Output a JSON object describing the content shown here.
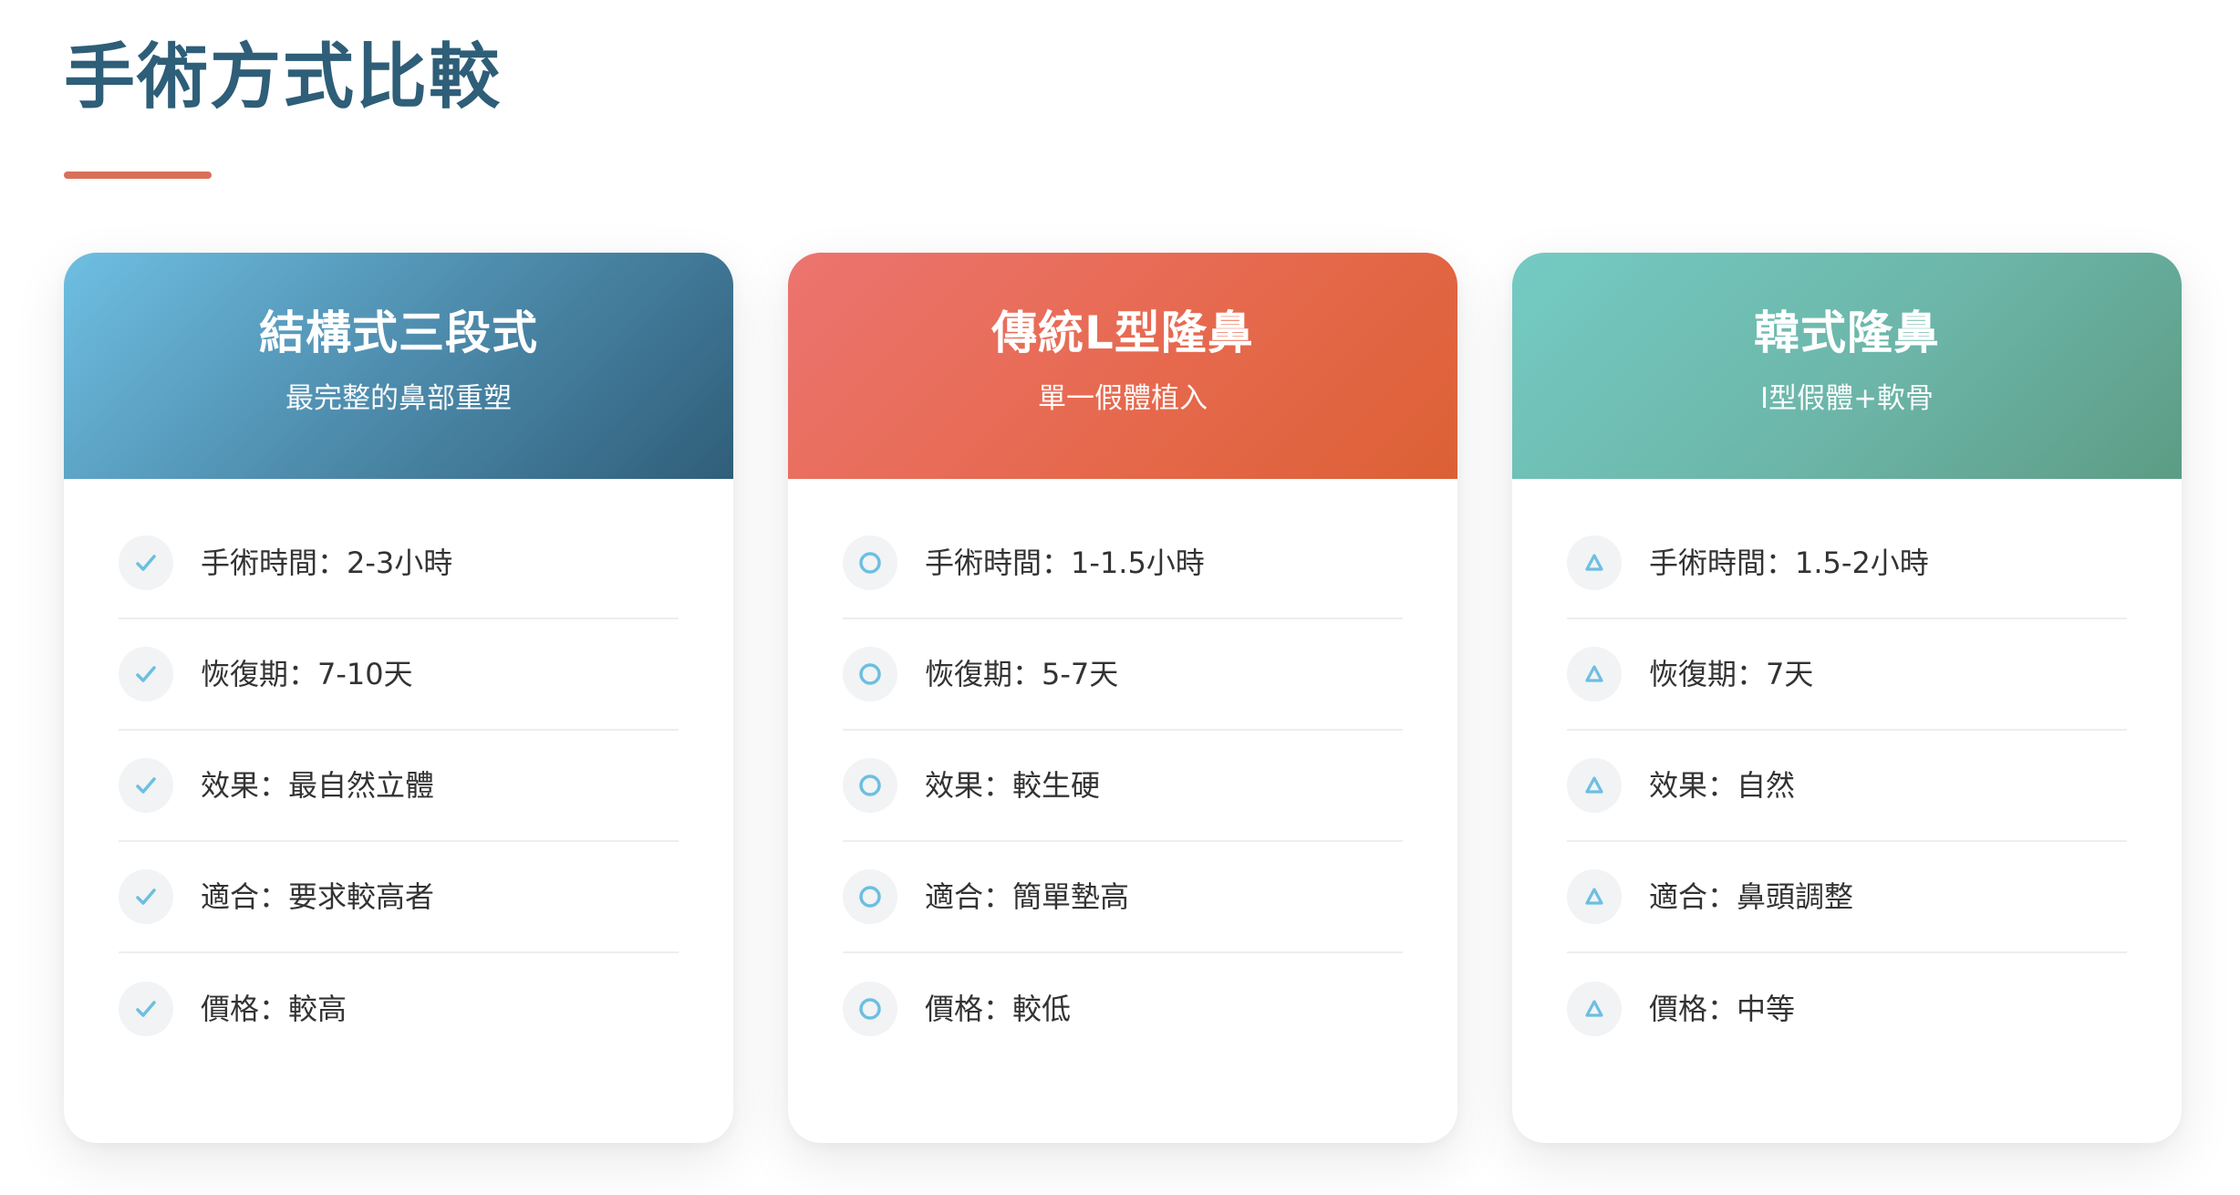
{
  "page": {
    "title": "手術方式比較",
    "accent_color": "#d9705a",
    "title_color": "#2e5e78"
  },
  "cards": [
    {
      "title": "結構式三段式",
      "subtitle": "最完整的鼻部重塑",
      "icon": "check-icon",
      "items": [
        "手術時間：2-3小時",
        "恢復期：7-10天",
        "效果：最自然立體",
        "適合：要求較高者",
        "價格：較高"
      ]
    },
    {
      "title": "傳統L型隆鼻",
      "subtitle": "單一假體植入",
      "icon": "circle-icon",
      "items": [
        "手術時間：1-1.5小時",
        "恢復期：5-7天",
        "效果：較生硬",
        "適合：簡單墊高",
        "價格：較低"
      ]
    },
    {
      "title": "韓式隆鼻",
      "subtitle": "I型假體+軟骨",
      "icon": "triangle-icon",
      "items": [
        "手術時間：1.5-2小時",
        "恢復期：7天",
        "效果：自然",
        "適合：鼻頭調整",
        "價格：中等"
      ]
    }
  ],
  "icon_color": "#6cbfe0"
}
